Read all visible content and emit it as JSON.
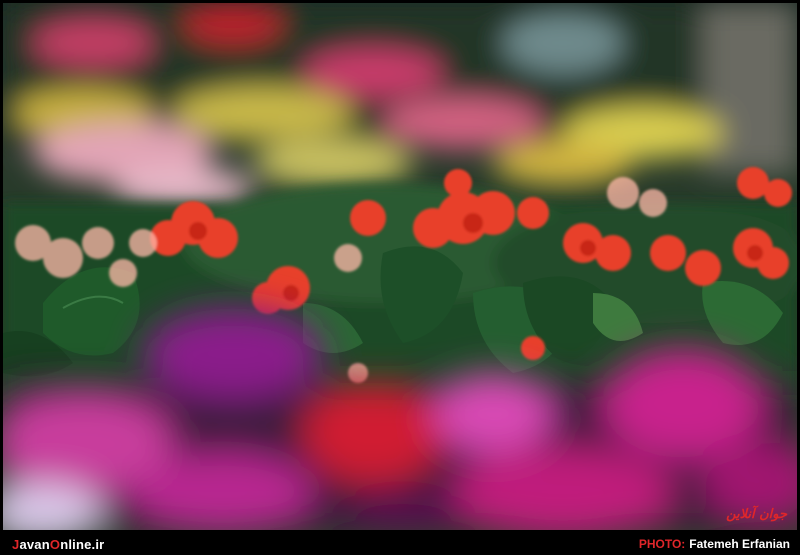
{
  "photo": {
    "subject": "",
    "watermark_text": "جوان آنلاین"
  },
  "footer": {
    "brand_prefix": "J",
    "brand_mid": "avan",
    "brand_o": "O",
    "brand_suffix": "nline.ir",
    "credit_label": "PHOTO:",
    "credit_name": "Fatemeh Erfanian"
  },
  "colors": {
    "accent": "#e0262a",
    "frame": "#000000",
    "begonia_red": "#e8412c",
    "cyclamen_magenta": "#c8208c"
  }
}
